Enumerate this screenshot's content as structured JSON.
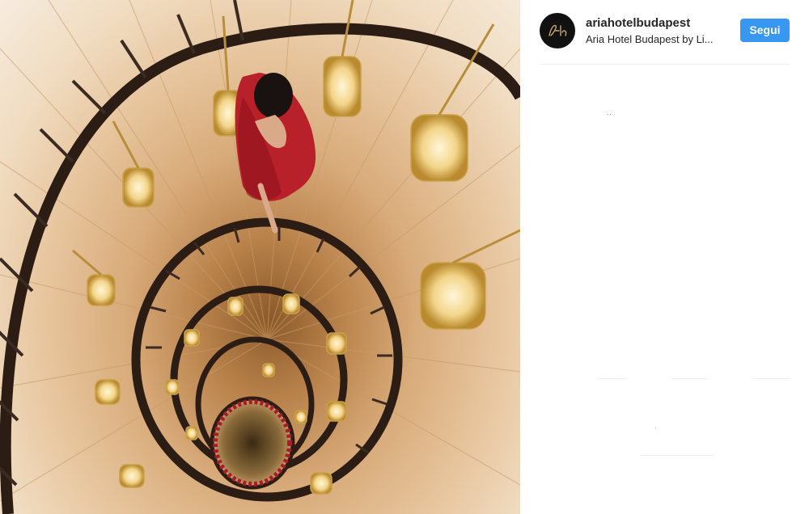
{
  "post": {
    "username": "ariahotelbudapest",
    "subtitle": "Aria Hotel Budapest by Li...",
    "follow_label": "Segui"
  },
  "colors": {
    "follow_button": "#3897f0",
    "username_text": "#262626",
    "divider": "#efefef"
  },
  "photo": {
    "subject": "spiral staircase with woman in red dress and hanging lamps"
  }
}
